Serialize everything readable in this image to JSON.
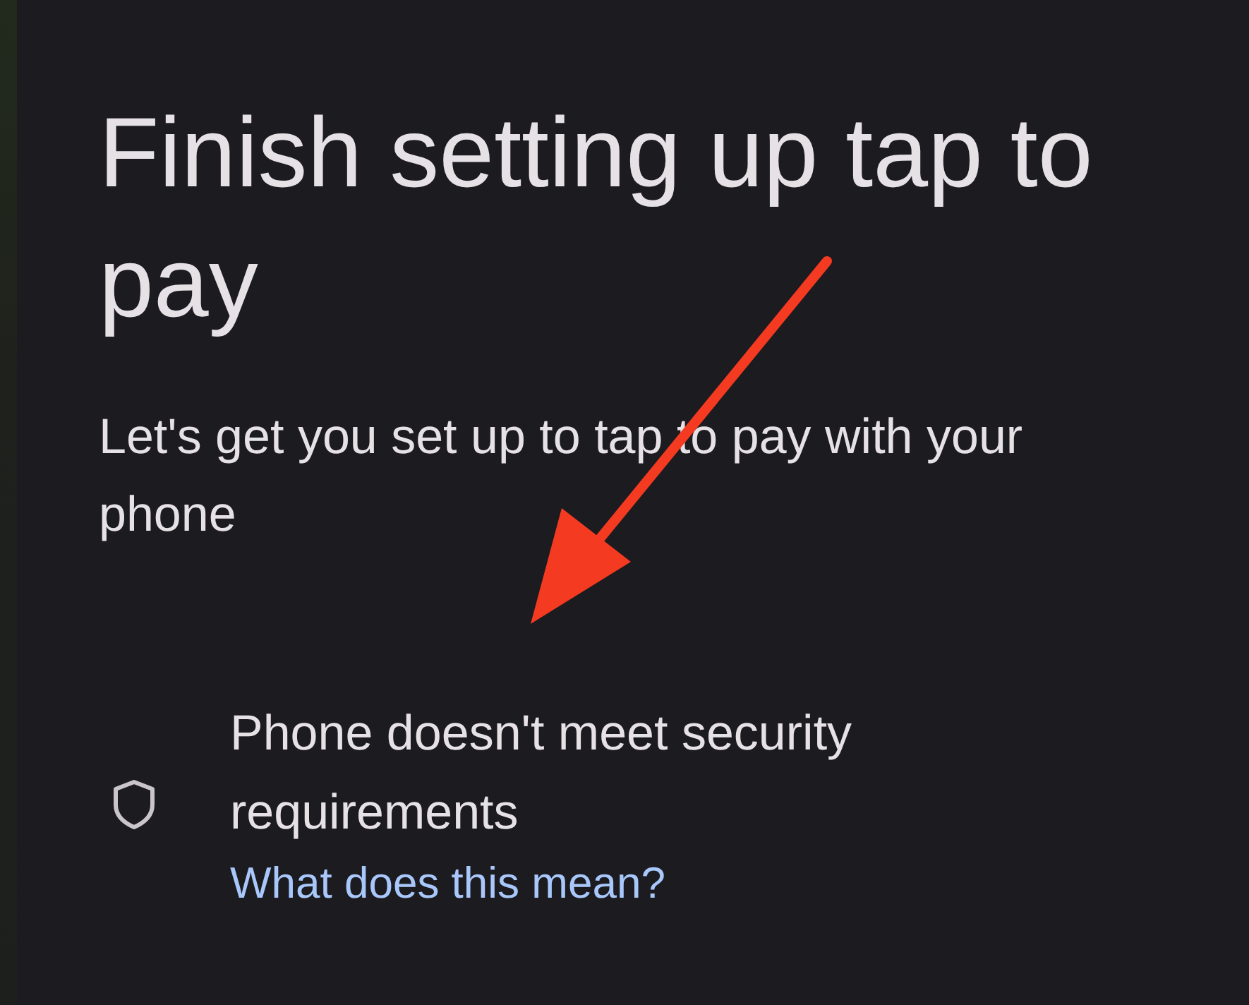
{
  "title": "Finish setting up tap to pay",
  "subtitle": "Let's get you set up to tap to pay with your phone",
  "requirements": [
    {
      "kind": "security",
      "message": "Phone doesn't meet security requirements",
      "link": "What does this mean?"
    }
  ]
}
